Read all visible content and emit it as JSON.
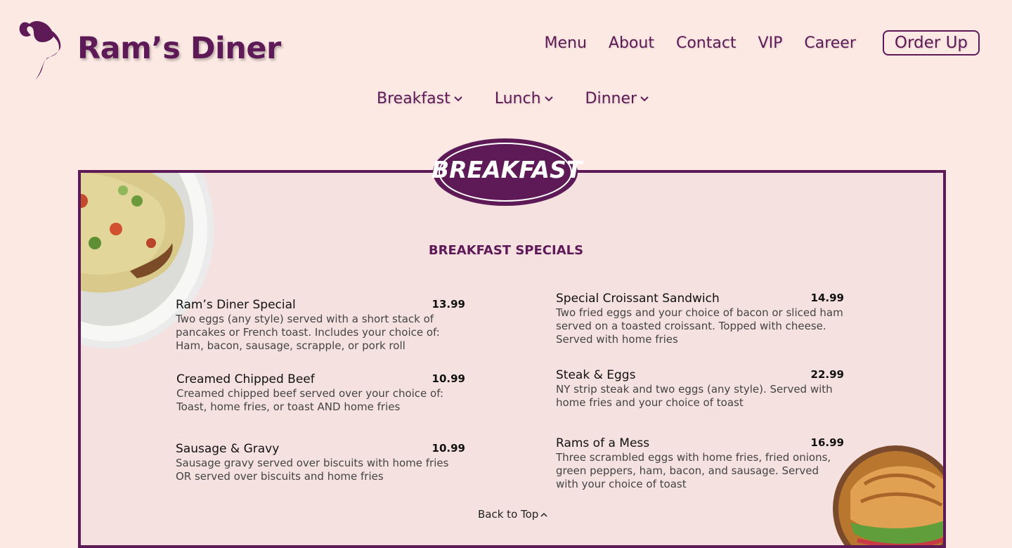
{
  "brand": {
    "name": "Ram’s Diner"
  },
  "nav": {
    "items": [
      {
        "label": "Menu"
      },
      {
        "label": "About"
      },
      {
        "label": "Contact"
      },
      {
        "label": "VIP"
      },
      {
        "label": "Career"
      }
    ],
    "cta": "Order Up"
  },
  "subnav": [
    {
      "label": "Breakfast"
    },
    {
      "label": "Lunch"
    },
    {
      "label": "Dinner"
    }
  ],
  "menu": {
    "badge": "BREAKFAST",
    "section_title": "BREAKFAST SPECIALS",
    "left": [
      {
        "name": "Ram’s Diner Special",
        "price": "13.99",
        "desc": "Two eggs (any style) served with a short stack of pancakes or French toast. Includes your choice of: Ham, bacon, sausage, scrapple, or pork roll"
      },
      {
        "name": "Creamed Chipped Beef",
        "price": "10.99",
        "desc": "Creamed chipped beef served over your choice of: Toast, home fries, or toast AND home fries"
      },
      {
        "name": "Sausage & Gravy",
        "price": "10.99",
        "desc": "Sausage gravy served over biscuits with home fries OR served over biscuits and home fries"
      }
    ],
    "right": [
      {
        "name": "Special Croissant Sandwich",
        "price": "14.99",
        "desc": "Two fried eggs and your choice of bacon or sliced ham served on a toasted croissant. Topped with cheese. Served with home fries"
      },
      {
        "name": "Steak & Eggs",
        "price": "22.99",
        "desc": "NY strip steak and two eggs (any style). Served with home fries and your choice of toast"
      },
      {
        "name": "Rams of a Mess",
        "price": "16.99",
        "desc": "Three scrambled eggs with home fries, fried onions, green peppers, ham, bacon, and sausage. Served with your choice of toast"
      }
    ],
    "back_to_top": "Back to Top"
  },
  "colors": {
    "brand": "#5e1a57",
    "page_bg": "#fde9e4",
    "menu_bg": "#f6e1e1"
  }
}
